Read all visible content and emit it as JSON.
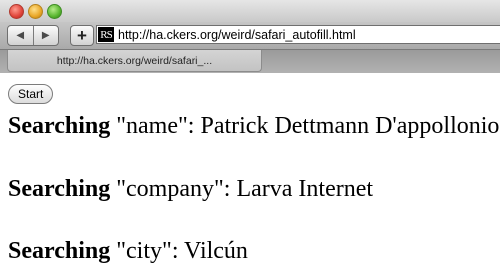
{
  "browser": {
    "favicon_text": "RS",
    "url": "http://ha.ckers.org/weird/safari_autofill.html",
    "tab_title": "http://ha.ckers.org/weird/safari_...",
    "nav": {
      "back_glyph": "◀",
      "forward_glyph": "▶",
      "add_glyph": "+"
    }
  },
  "page": {
    "start_label": "Start",
    "results": [
      {
        "prefix": "Searching",
        "text": " \"name\": Patrick Dettmann D'appollonio"
      },
      {
        "prefix": "Searching",
        "text": " \"company\": Larva Internet"
      },
      {
        "prefix": "Searching",
        "text": " \"city\": Vilcún"
      }
    ]
  }
}
